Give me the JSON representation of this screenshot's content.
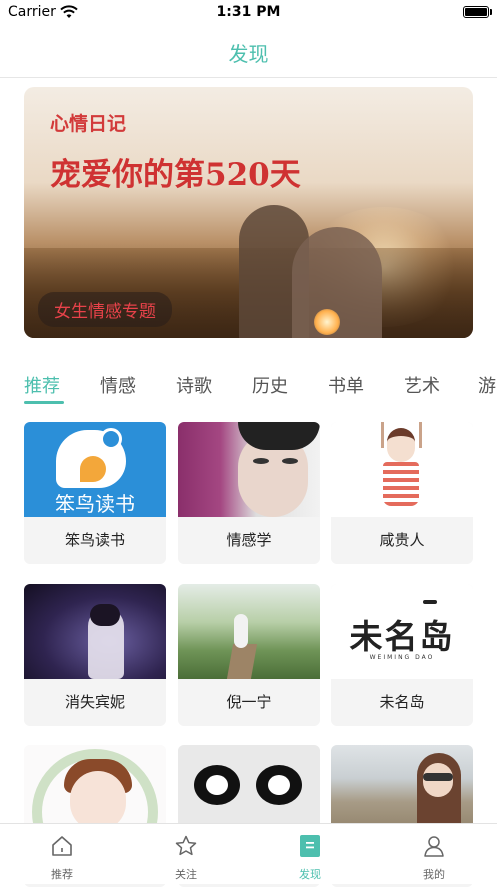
{
  "status_bar": {
    "carrier": "Carrier",
    "time": "1:31 PM"
  },
  "navbar": {
    "title": "发现"
  },
  "banner": {
    "title_small": "心情日记",
    "title_large": "宠爱你的第520天",
    "tag": "女生情感专题"
  },
  "category_tabs": {
    "active_index": 0,
    "items": [
      "推荐",
      "情感",
      "诗歌",
      "历史",
      "书单",
      "艺术",
      "游"
    ]
  },
  "cards": [
    {
      "label": "笨鸟读书",
      "image_text": "笨鸟读书"
    },
    {
      "label": "情感学"
    },
    {
      "label": "咸贵人"
    },
    {
      "label": "消失宾妮"
    },
    {
      "label": "倪一宁"
    },
    {
      "label": "未名岛",
      "image_text": "未名岛",
      "image_subtext": "WEIMING DAO"
    },
    {
      "label": ""
    },
    {
      "label": ""
    },
    {
      "label": ""
    }
  ],
  "tab_bar": {
    "active_index": 2,
    "items": [
      {
        "label": "推荐",
        "icon": "home-icon"
      },
      {
        "label": "关注",
        "icon": "star-icon"
      },
      {
        "label": "发现",
        "icon": "discover-icon"
      },
      {
        "label": "我的",
        "icon": "profile-icon"
      }
    ]
  },
  "colors": {
    "accent": "#4dbfae",
    "banner_text": "#d23a3a"
  }
}
